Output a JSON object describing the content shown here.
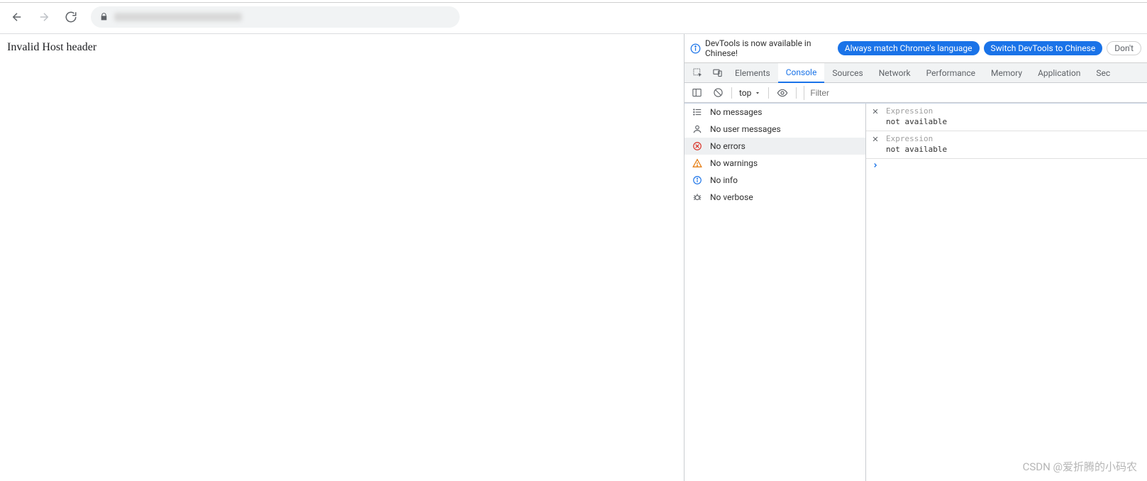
{
  "browser": {
    "back_enabled": true,
    "forward_enabled": false
  },
  "page": {
    "body_text": "Invalid Host header"
  },
  "devtools": {
    "infobar": {
      "message": "DevTools is now available in Chinese!",
      "btn_match": "Always match Chrome's language",
      "btn_switch": "Switch DevTools to Chinese",
      "btn_dont": "Don't"
    },
    "tabs": [
      "Elements",
      "Console",
      "Sources",
      "Network",
      "Performance",
      "Memory",
      "Application",
      "Sec"
    ],
    "active_tab": "Console",
    "toolbar": {
      "context": "top",
      "filter_placeholder": "Filter"
    },
    "sidebar": [
      {
        "icon": "list",
        "label": "No messages"
      },
      {
        "icon": "user",
        "label": "No user messages"
      },
      {
        "icon": "error",
        "label": "No errors",
        "active": true
      },
      {
        "icon": "warn",
        "label": "No warnings"
      },
      {
        "icon": "info",
        "label": "No info"
      },
      {
        "icon": "bug",
        "label": "No verbose"
      }
    ],
    "watches": [
      {
        "label": "Expression",
        "value": "not available"
      },
      {
        "label": "Expression",
        "value": "not available"
      }
    ]
  },
  "watermark": "CSDN @爱折腾的小码农"
}
